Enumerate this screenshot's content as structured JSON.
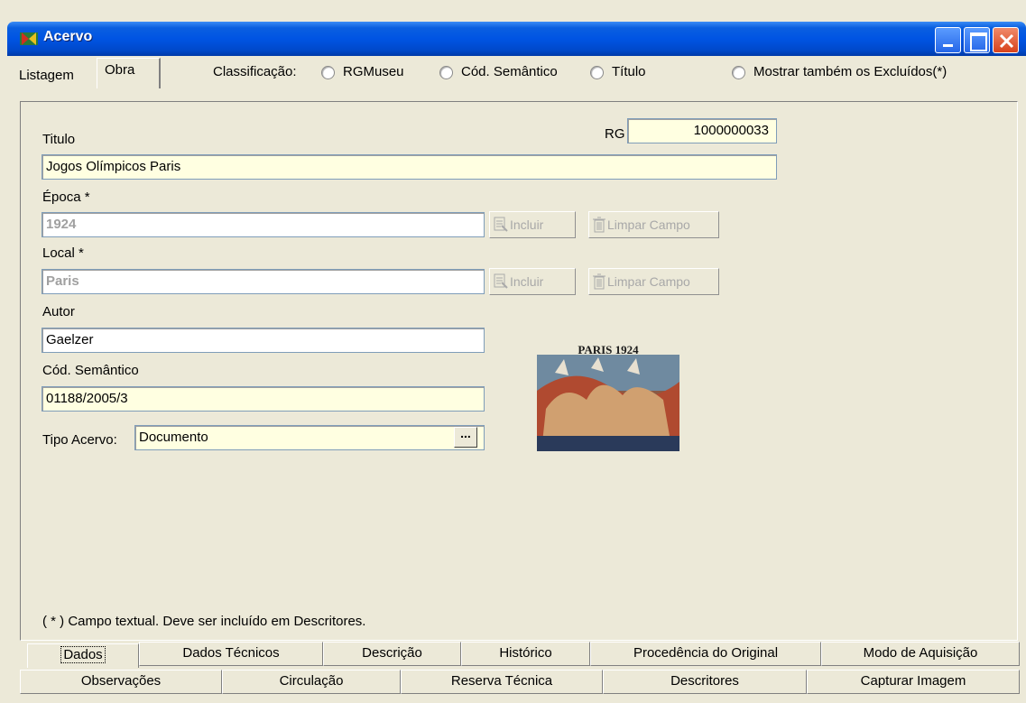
{
  "window": {
    "title": "Acervo"
  },
  "top_tabs": {
    "listagem": "Listagem",
    "obra": "Obra"
  },
  "classificacao": {
    "label": "Classificação:",
    "options": [
      "RGMuseu",
      "Cód. Semântico",
      "Título"
    ],
    "show_excluded": "Mostrar também os Excluídos(*)"
  },
  "form": {
    "rg_label": "RG",
    "rg_value": "1000000033",
    "titulo_label": "Titulo",
    "titulo_value": "Jogos Olímpicos Paris",
    "epoca_label": "Época *",
    "epoca_value": "1924",
    "local_label": "Local *",
    "local_value": "Paris",
    "autor_label": "Autor",
    "autor_value": "Gaelzer",
    "cod_label": "Cód. Semântico",
    "cod_value": "01188/2005/3",
    "tipo_label": "Tipo Acervo:",
    "tipo_value": "Documento",
    "ellipsis": "...",
    "incluir": "Incluir",
    "limpar": "Limpar Campo",
    "footnote": "( * ) Campo textual. Deve ser incluído em Descritores."
  },
  "poster": {
    "caption": "PARIS 1924"
  },
  "bottom_tabs_row1": [
    "Dados",
    "Dados Técnicos",
    "Descrição",
    "Histórico",
    "Procedência do Original",
    "Modo de Aquisição"
  ],
  "bottom_tabs_row2": [
    "Observações",
    "Circulação",
    "Reserva Técnica",
    "Descritores",
    "Capturar Imagem"
  ],
  "colors": {
    "field_bg": "#ffffe1",
    "titlebar": "#0054e3",
    "window_bg": "#ece9d8"
  }
}
